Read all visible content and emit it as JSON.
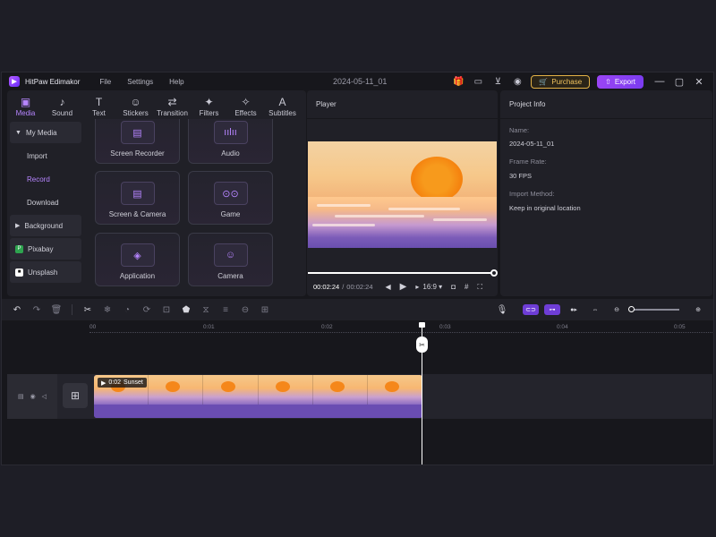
{
  "app": {
    "name": "HitPaw Edimakor",
    "menus": [
      "File",
      "Settings",
      "Help"
    ],
    "project_title": "2024-05-11_01",
    "purchase_label": "Purchase",
    "export_label": "Export"
  },
  "tabs": [
    {
      "label": "Media",
      "icon": "media-icon",
      "glyph": "▣",
      "active": true
    },
    {
      "label": "Sound",
      "icon": "music-note-icon",
      "glyph": "♪",
      "active": false
    },
    {
      "label": "Text",
      "icon": "text-icon",
      "glyph": "T",
      "active": false
    },
    {
      "label": "Stickers",
      "icon": "sticker-icon",
      "glyph": "☺",
      "active": false
    },
    {
      "label": "Transition",
      "icon": "transition-icon",
      "glyph": "⇄",
      "active": false
    },
    {
      "label": "Filters",
      "icon": "sparkle-icon",
      "glyph": "✦",
      "active": false
    },
    {
      "label": "Effects",
      "icon": "effects-icon",
      "glyph": "✧",
      "active": false
    },
    {
      "label": "Subtitles",
      "icon": "subtitles-icon",
      "glyph": "A",
      "active": false
    }
  ],
  "sidebar": {
    "my_media": "My Media",
    "import": "Import",
    "record": "Record",
    "download": "Download",
    "background": "Background",
    "pixabay": "Pixabay",
    "unsplash": "Unsplash"
  },
  "record_cards": [
    {
      "label": "Screen Recorder",
      "icon": "screen-recorder-icon",
      "glyph": "▤"
    },
    {
      "label": "Audio",
      "icon": "audio-wave-icon",
      "glyph": "ıılıı"
    },
    {
      "label": "Screen & Camera",
      "icon": "screen-camera-icon",
      "glyph": "▤"
    },
    {
      "label": "Game",
      "icon": "gamepad-icon",
      "glyph": "⊙⊙"
    },
    {
      "label": "Application",
      "icon": "layers-icon",
      "glyph": "◈"
    },
    {
      "label": "Camera",
      "icon": "webcam-icon",
      "glyph": "☺"
    }
  ],
  "player": {
    "title": "Player",
    "current_time": "00:02:24",
    "separator": "/",
    "total_time": "00:02:24",
    "aspect_ratio": "16:9",
    "progress": 1.0
  },
  "project_info": {
    "title": "Project Info",
    "name_label": "Name:",
    "name_value": "2024-05-11_01",
    "frame_rate_label": "Frame Rate:",
    "frame_rate_value": "30 FPS",
    "import_method_label": "Import Method:",
    "import_method_value": "Keep in original location"
  },
  "timeline": {
    "ruler": [
      "00",
      "0:01",
      "0:02",
      "0:03",
      "0:04",
      "0:05"
    ],
    "clip": {
      "duration": "0:02",
      "name": "Sunset"
    }
  },
  "colors": {
    "accent": "#9a45f5",
    "purchase": "#e3b246"
  }
}
